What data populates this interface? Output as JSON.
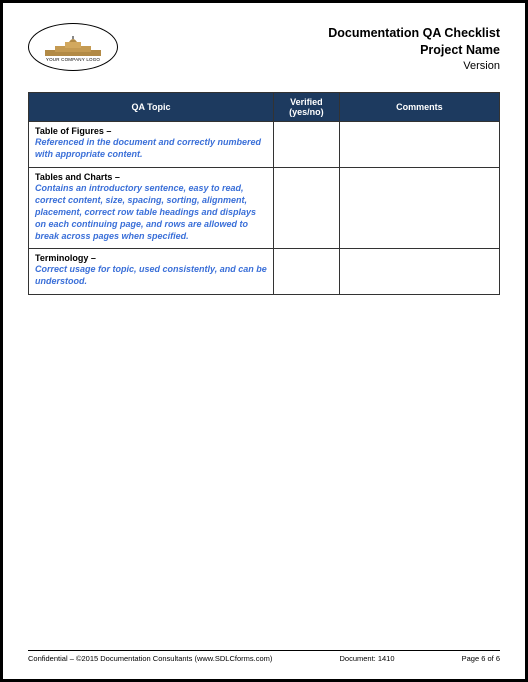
{
  "header": {
    "logo_caption": "YOUR COMPANY LOGO",
    "title_line1": "Documentation QA Checklist",
    "title_line2": "Project Name",
    "version": "Version"
  },
  "table": {
    "col_topic": "QA Topic",
    "col_verified": "Verified (yes/no)",
    "col_comments": "Comments",
    "rows": [
      {
        "title": "Table of Figures –",
        "desc": "Referenced in the document and correctly numbered with appropriate content.",
        "verified": "",
        "comments": ""
      },
      {
        "title": "Tables and Charts –",
        "desc": "Contains an introductory sentence, easy to read, correct content, size, spacing, sorting, alignment, placement, correct row table headings and displays on each continuing page, and rows are allowed to break across pages when specified.",
        "verified": "",
        "comments": ""
      },
      {
        "title": "Terminology –",
        "desc": "Correct usage for topic, used consistently, and can be understood.",
        "verified": "",
        "comments": ""
      }
    ]
  },
  "footer": {
    "left": "Confidential – ©2015 Documentation Consultants (www.SDLCforms.com)",
    "mid": "Document: 1410",
    "right": "Page 6 of 6"
  }
}
